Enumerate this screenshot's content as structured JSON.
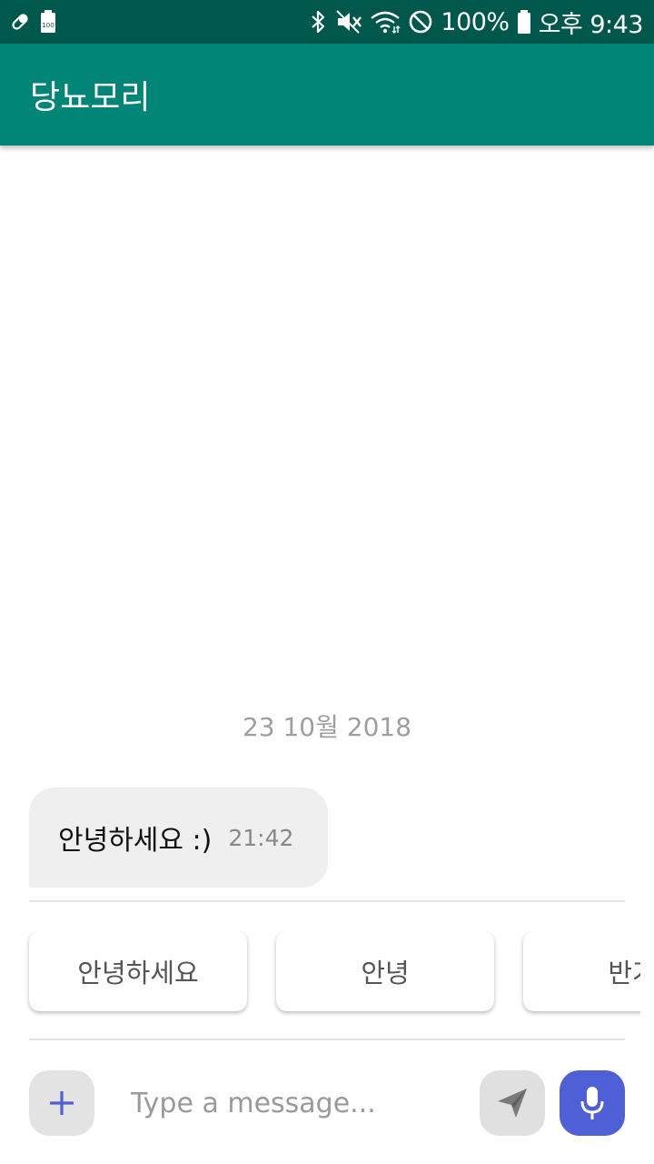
{
  "status_bar": {
    "battery_percent": "100%",
    "time": "오후 9:43",
    "left_icons": [
      "pill-icon",
      "battery-100-icon"
    ],
    "right_icons": [
      "bluetooth-icon",
      "mute-icon",
      "wifi-icon",
      "do-not-disturb-icon",
      "battery-icon"
    ]
  },
  "app_bar": {
    "title": "당뇨모리",
    "color": "#008577"
  },
  "chat": {
    "date": "23 10월 2018",
    "messages": [
      {
        "text": "안녕하세요 :)",
        "time": "21:42"
      }
    ]
  },
  "quick_replies": [
    "안녕하세요",
    "안녕",
    "반가"
  ],
  "input_bar": {
    "placeholder": "Type a message...",
    "icons": [
      "plus-icon",
      "send-icon",
      "mic-icon"
    ],
    "mic_color": "#4f5fd6"
  }
}
